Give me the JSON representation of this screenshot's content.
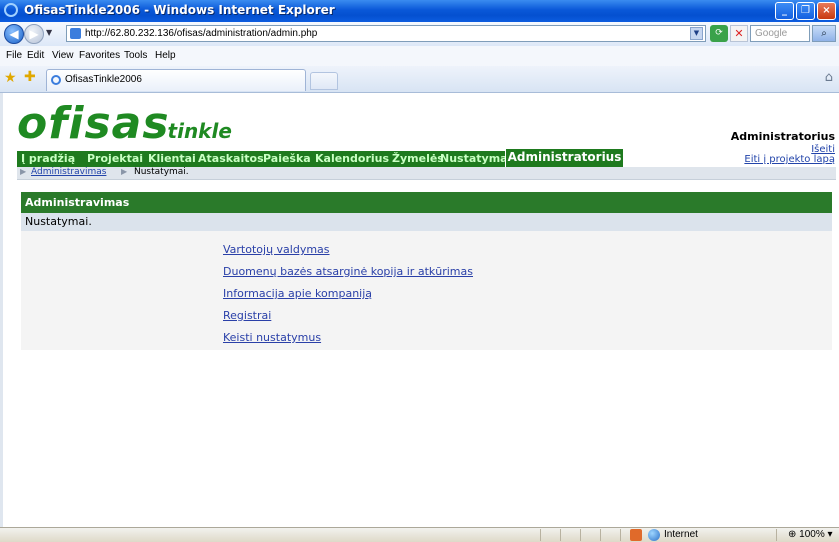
{
  "window": {
    "title": "OfisasTinkle2006 - Windows Internet Explorer",
    "minimize_glyph": "_",
    "maximize_glyph": "❐",
    "close_glyph": "×"
  },
  "browser": {
    "url": "http://62.80.232.136/ofisas/administration/admin.php",
    "search_placeholder": "Google",
    "menu": [
      "File",
      "Edit",
      "View",
      "Favorites",
      "Tools",
      "Help"
    ],
    "tab_title": "OfisasTinkle2006"
  },
  "site": {
    "logo_main": "ofisas",
    "logo_suffix": "tinkle",
    "user_name": "Administratorius",
    "logout_label": "Išeiti",
    "project_link_label": "Eiti į projekto lapą",
    "nav": [
      "Į pradžią",
      "Projektai",
      "Klientai",
      "Ataskaitos",
      "Paieška",
      "Kalendorius",
      "Žymelės",
      "Nustatymai"
    ],
    "nav_active": "Administratorius",
    "breadcrumb": {
      "link": "Administravimas",
      "current": "Nustatymai."
    }
  },
  "panel": {
    "header": "Administravimas",
    "subheader": "Nustatymai.",
    "links": [
      "Vartotojų valdymas",
      "Duomenų bazės atsarginė kopija ir atkūrimas",
      "Informacija apie kompaniją",
      "Registrai",
      "Keisti nustatymus"
    ]
  },
  "status": {
    "zone": "Internet",
    "zoom": "100%"
  },
  "colors": {
    "brand_green": "#1e7a1e",
    "panel_header": "#2a7a2a",
    "link_blue": "#2a40a8",
    "titlebar_blue": "#0a58d8"
  },
  "icons": [
    "ie-logo-icon",
    "back-icon",
    "forward-icon",
    "refresh-icon",
    "stop-icon",
    "search-icon",
    "favorites-star-icon",
    "add-favorites-icon",
    "home-icon",
    "internet-zone-icon",
    "zoom-icon"
  ]
}
